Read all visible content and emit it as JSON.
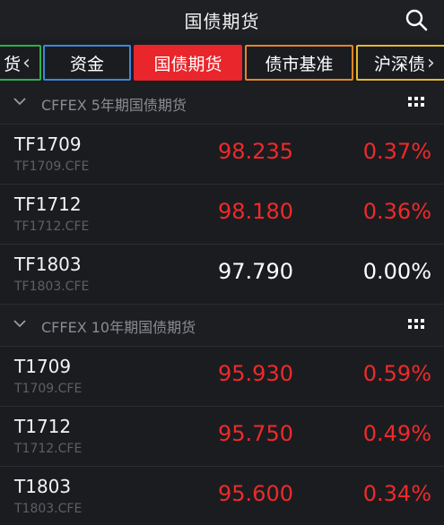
{
  "header": {
    "title": "国债期货",
    "search_icon": "search-icon"
  },
  "tabs": [
    {
      "label": "货",
      "chevron": "‹",
      "border": "#2bb24c"
    },
    {
      "label": "资金",
      "border": "#3a87d9"
    },
    {
      "label": "国债期货",
      "border": "#e8262b",
      "active": true
    },
    {
      "label": "债市基准",
      "border": "#e4852a"
    },
    {
      "label": "沪深债",
      "chevron": "›",
      "border": "#e6b92c"
    }
  ],
  "sections": [
    {
      "title": "CFFEX 5年期国债期货",
      "rows": [
        {
          "code": "TF1709",
          "sub": "TF1709.CFE",
          "price": "98.235",
          "pct": "0.37%",
          "trend": "up"
        },
        {
          "code": "TF1712",
          "sub": "TF1712.CFE",
          "price": "98.180",
          "pct": "0.36%",
          "trend": "up"
        },
        {
          "code": "TF1803",
          "sub": "TF1803.CFE",
          "price": "97.790",
          "pct": "0.00%",
          "trend": "flat"
        }
      ]
    },
    {
      "title": "CFFEX 10年期国债期货",
      "rows": [
        {
          "code": "T1709",
          "sub": "T1709.CFE",
          "price": "95.930",
          "pct": "0.59%",
          "trend": "up"
        },
        {
          "code": "T1712",
          "sub": "T1712.CFE",
          "price": "95.750",
          "pct": "0.49%",
          "trend": "up"
        },
        {
          "code": "T1803",
          "sub": "T1803.CFE",
          "price": "95.600",
          "pct": "0.34%",
          "trend": "up"
        }
      ]
    }
  ],
  "colors": {
    "up": "#ee2a2a",
    "flat": "#ffffff",
    "background": "#1b1c20"
  }
}
